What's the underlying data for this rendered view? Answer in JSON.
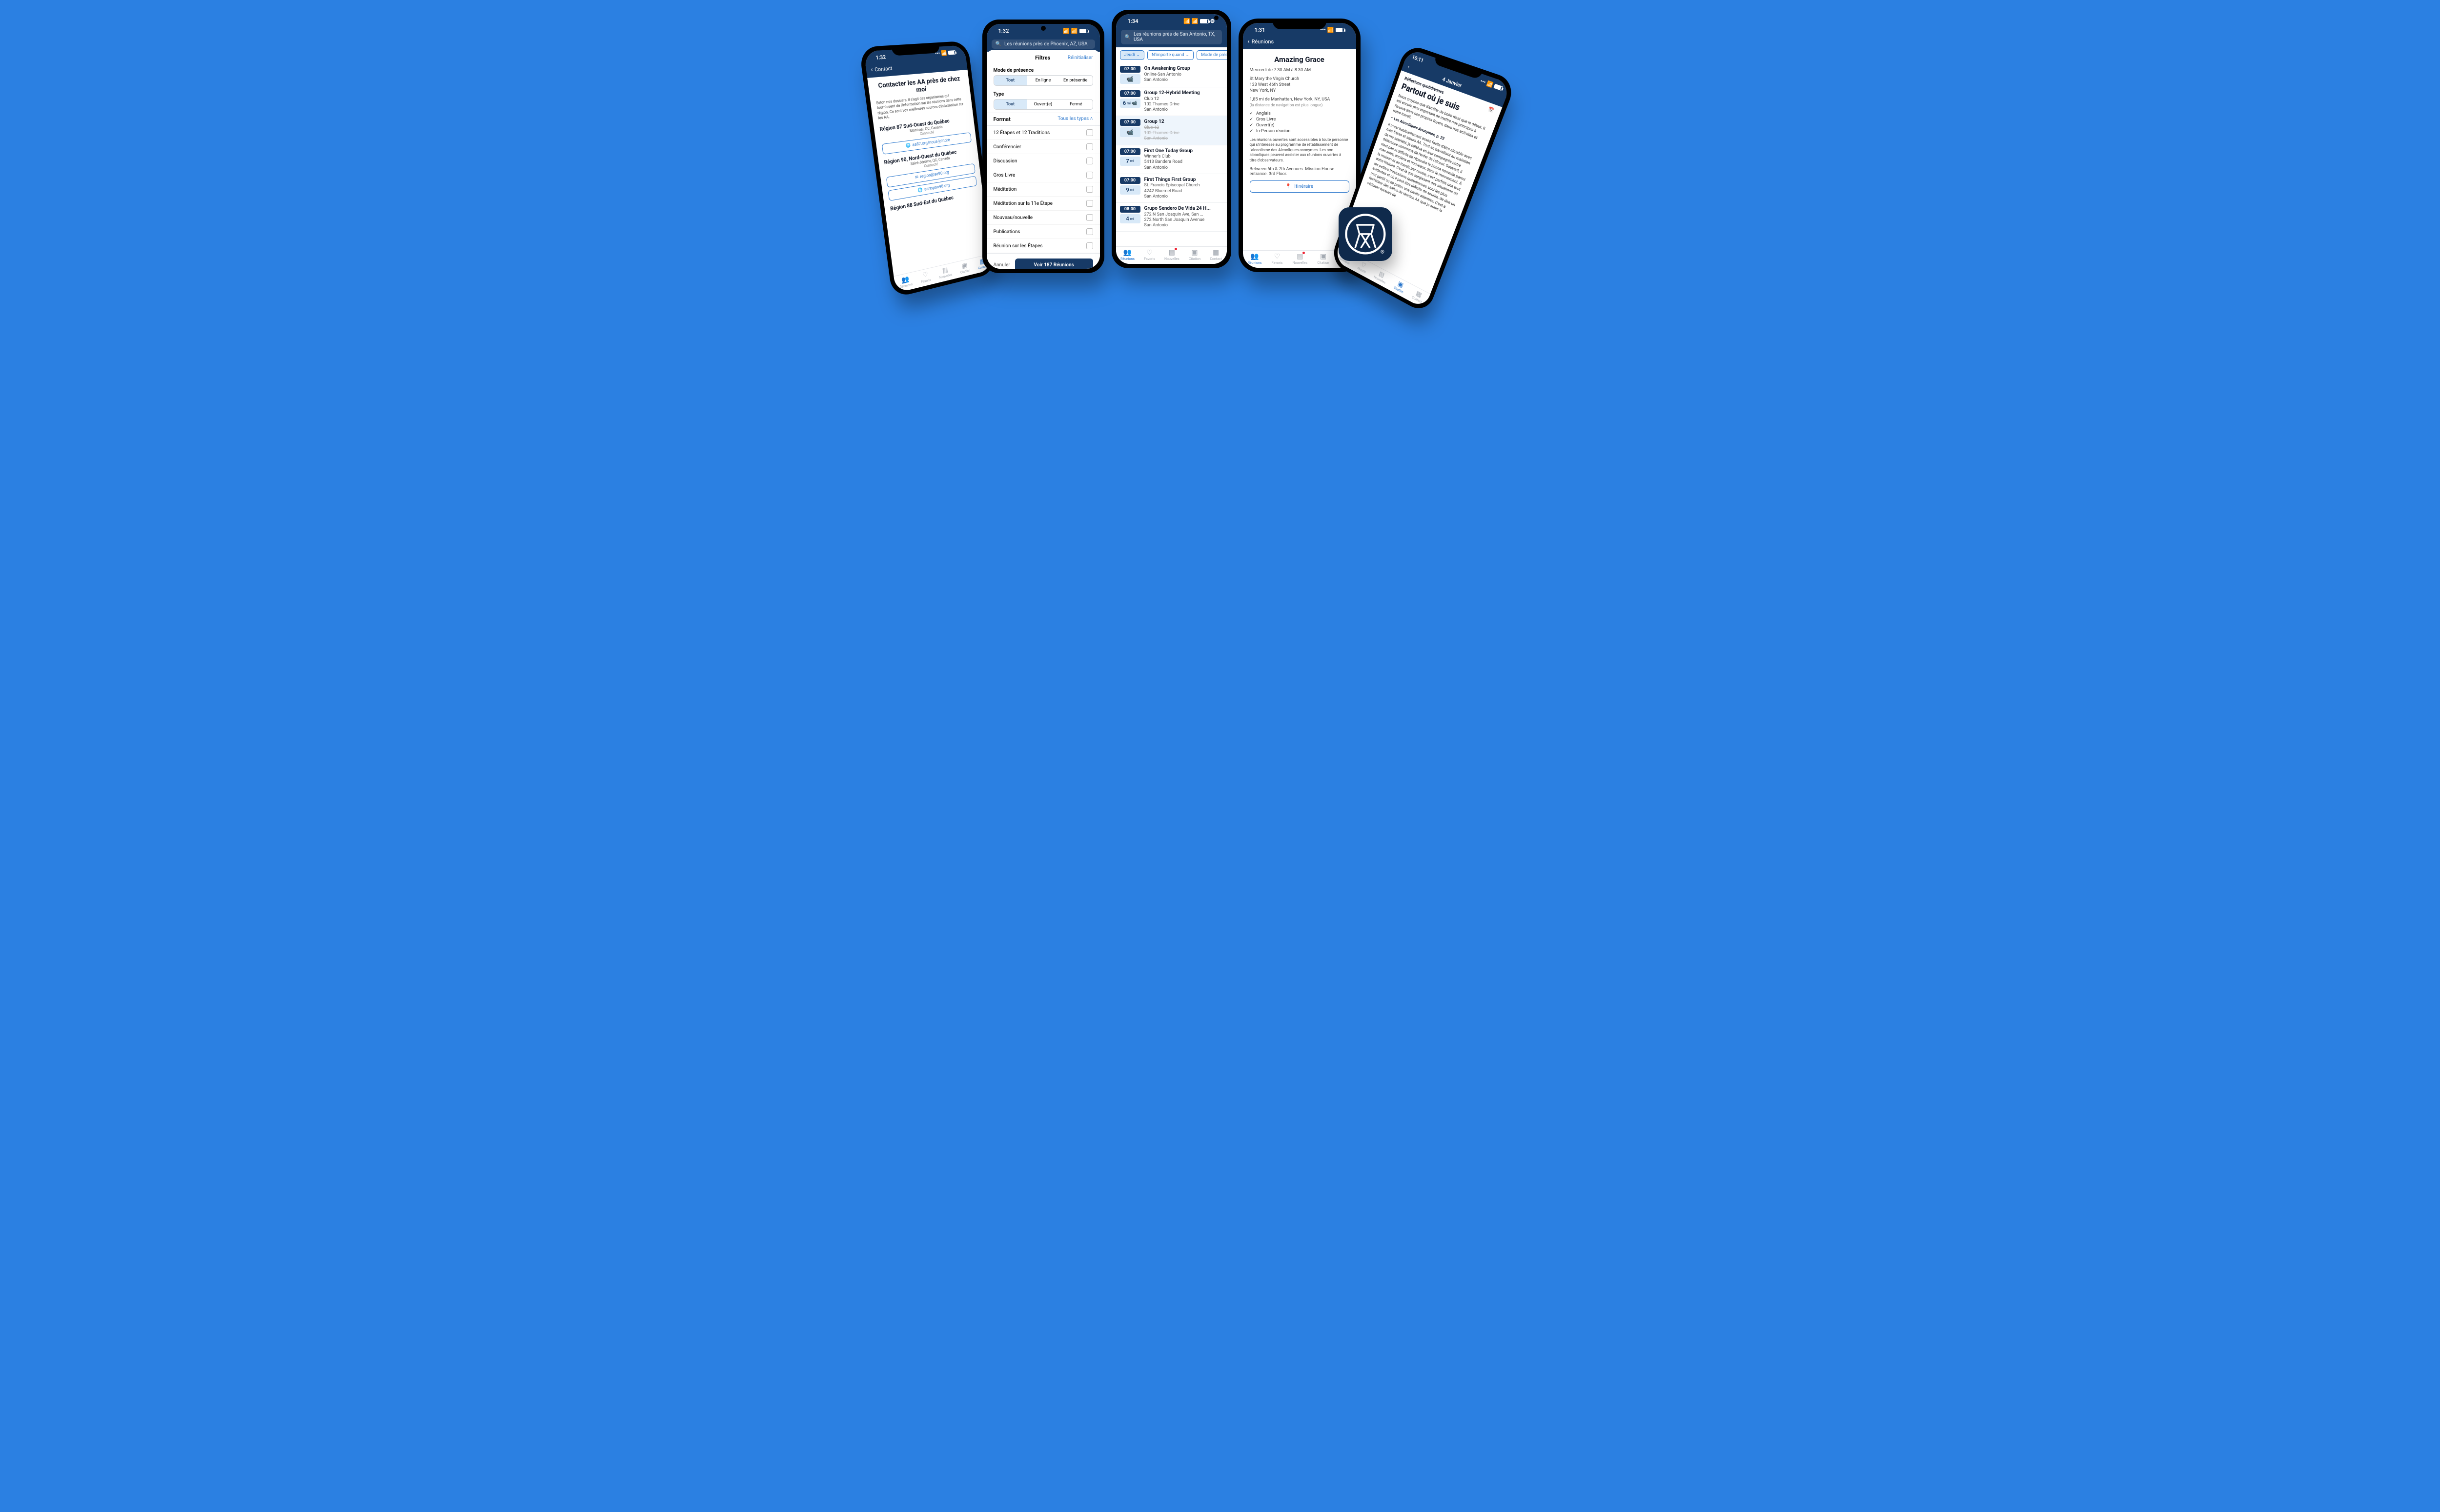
{
  "phone1": {
    "time": "1:32",
    "back": "Contact",
    "title": "Contacter les AA près de chez moi",
    "intro": "Selon nos dossiers, il s'agit des organismes qui fournissent de l'information sur les réunions dans cette région. Ce sont vos meilleures sources d'information sur les AA.",
    "regions": [
      {
        "name": "Région 87 Sud-Ouest du Québec",
        "loc": "Montreal, QC, Canada",
        "status": "Connecté",
        "links": [
          "aa87.org/nous-joindre"
        ]
      },
      {
        "name": "Région 90, Nord-Ouest du Québec",
        "loc": "Saint-Jérôme, QC, Canada",
        "status": "Connecté",
        "links": [
          "region@aa90.org",
          "aaregion90.org"
        ]
      },
      {
        "name": "Région 88 Sud-Est du Québec",
        "loc": "",
        "status": "",
        "links": []
      }
    ]
  },
  "phone2": {
    "time": "1:32",
    "search": "Les réunions près de Phoenix, AZ, USA",
    "sheetTitle": "Filtres",
    "reset": "Réinitialiser",
    "presenceLabel": "Mode de présence",
    "presence": [
      "Tout",
      "En ligne",
      "En présentiel"
    ],
    "typeLabel": "Type",
    "type": [
      "Tout",
      "Ouvert(e)",
      "Fermé"
    ],
    "formatLabel": "Format",
    "allTypes": "Tous les types",
    "formats": [
      "12 Étapes et 12 Traditions",
      "Conférencier",
      "Discussion",
      "Gros Livre",
      "Méditation",
      "Méditation sur la 11e Étape",
      "Nouveau/nouvelle",
      "Publications",
      "Réunion sur les Étapes"
    ],
    "cancel": "Annuler",
    "apply": "Voir 187 Réunions"
  },
  "phone3": {
    "time": "1:34",
    "search": "Les réunions près de San Antonio, TX, USA",
    "chips": [
      "Jeudi",
      "N'importe quand",
      "Mode de présenc"
    ],
    "chipArrow": "⌄",
    "meetings": [
      {
        "time": "07:00",
        "dist": "",
        "cam": true,
        "name": "On Awakening Group",
        "l1": "Online-San Antonio",
        "l2": "San Antonio",
        "l3": "",
        "sel": false,
        "strike": false
      },
      {
        "time": "07:00",
        "dist": "6",
        "cam": true,
        "name": "Group 12-Hybrid Meeting",
        "l1": "Club 12",
        "l2": "102 Thames Drive",
        "l3": "San Antonio",
        "sel": false,
        "strike": false
      },
      {
        "time": "07:00",
        "dist": "",
        "cam": true,
        "name": "Group 12",
        "l1": "Club 12",
        "l2": "102 Thames Drive",
        "l3": "San Antonio",
        "sel": true,
        "strike": true
      },
      {
        "time": "07:00",
        "dist": "7",
        "cam": false,
        "name": "First One Today Group",
        "l1": "Winner's Club",
        "l2": "5413 Bandera Road",
        "l3": "San Antonio",
        "sel": false,
        "strike": false
      },
      {
        "time": "07:00",
        "dist": "9",
        "cam": false,
        "name": "First Things First Group",
        "l1": "St. Francis Episcopal Church",
        "l2": "4242 Bluemel Road",
        "l3": "San Antonio",
        "sel": false,
        "strike": false
      },
      {
        "time": "08:00",
        "dist": "4",
        "cam": false,
        "name": "Grupo Sendero De Vida 24 H...",
        "l1": "272 N San Joaquin Ave, San ...",
        "l2": "272 North San Joaquin Avenue",
        "l3": "San Antonio",
        "sel": false,
        "strike": false
      }
    ],
    "miLabel": "mi"
  },
  "phone4": {
    "time": "1:31",
    "back": "Réunions",
    "title": "Amazing Grace",
    "when": "Mercredi de 7:30 AM à 8:30 AM",
    "venue": [
      "St Mary the Virgin Church",
      "133 West 46th Street",
      "New York, NY"
    ],
    "dist": "1,85 mi de Manhattan, New York, NY, USA",
    "distNote": "(la distance de navigation est plus longue)",
    "tags": [
      "Anglais",
      "Gros Livre",
      "Ouvert(e)",
      "In-Person réunion"
    ],
    "openInfo": "Les réunions ouvertes sont accessibles à toute personne qui s'intéresse au programme de rétablissement de l'alcoolisme des Alcooliques anonymes. Les non-alcooliques peuvent assister aux réunions ouvertes à titre d'observateurs.",
    "loc": "Between 6th & 7th Avenues. Mission House entrance. 3rd Floor.",
    "route": "Itinéraire"
  },
  "phone5": {
    "time": "10:11",
    "date": "4 Janvier",
    "sub": "Réflexions quotidiennes",
    "title": "Partout où je suis",
    "p1": "Nous croyons que d'arrêter de boire n'est que le début. Il est encore plus important de mettre nos principes à l'œuvre dans nos propres foyers, dans nos activités et notre travail.",
    "src": "— Les Alcooliques Anonymes, p. 22",
    "p2": "Il m'est habituellement assez facile d'être aimable avec mes frères et sœurs AA. Tout en travaillant au maintien de ma sobriété, je célèbre en leur compagnie notre délivrance commune de l'enfer de l'alcool. Souvent, il n'est pas si difficile de répandre la bonne nouvelle parmi mes amis, anciens et nouveaux, dans le mouvement. À la maison et au travail, par contre, c'est parfois une tout autre histoire. C'est là que surgissent des situations où les petites frustrations quotidiennes sont les plus évidentes et où il peut être difficile de sourire, de dire un mot gentil ou de prêter une oreille attentive. C'est à l'extérieur des salles de réunion AA que je subis la véritable épreuve de"
  },
  "tabs": {
    "reunions": "Réunions",
    "favoris": "Favoris",
    "nouvelles": "Nouvelles",
    "citation": "Citation",
    "contact": "Contact"
  },
  "icons": {
    "search": "🔍",
    "globe": "🌐",
    "mail": "✉",
    "cam": "📹",
    "pin": "📍",
    "cal": "📅",
    "heart": "♡",
    "news": "📰",
    "quote": "❝",
    "contact": "📇",
    "people": "👥"
  }
}
